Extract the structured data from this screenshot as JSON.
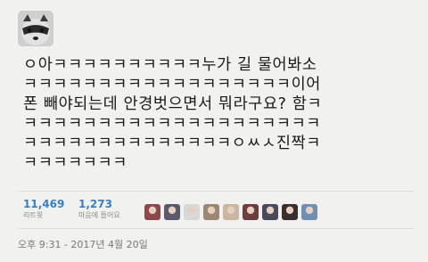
{
  "tweet": {
    "lines": [
      "ㅇ아ㅋㅋㅋㅋㅋㅋㅋㅋㅋㅋ누가 길 물어봐소",
      "ㅋㅋㅋㅋㅋㅋㅋㅋㅋㅋㅋㅋㅋㅋㅋㅋㅋㅋ이어",
      "폰 빼야되는데 안경벗으면서 뭐라구요? 함ㅋ",
      "ㅋㅋㅋㅋㅋㅋㅋㅋㅋㅋㅋㅋㅋㅋㅋㅋㅋㅋㅋㅋ",
      "ㅋㅋㅋㅋㅋㅋㅋㅋㅋㅋㅋㅋㅋㅋㅇㅆㅅ진짝ㅋ",
      "ㅋㅋㅋㅋㅋㅋㅋ"
    ]
  },
  "stats": {
    "retweets": {
      "count": "11,469",
      "label": "리트윗"
    },
    "likes": {
      "count": "1,273",
      "label": "마음에 들어요"
    }
  },
  "likers": {
    "colors": [
      "#8b4a4a",
      "#5a5a6a",
      "#d8d8d8",
      "#9a8874",
      "#c8b8a0",
      "#6b3f3f",
      "#4a4a5a",
      "#3d2e2e",
      "#6f90b0"
    ]
  },
  "timestamp": "오후 9:31 - 2017년 4월 20일",
  "colors": {
    "link": "#3a80c0",
    "muted": "#8a8a8a",
    "background": "#f1f1ef"
  }
}
